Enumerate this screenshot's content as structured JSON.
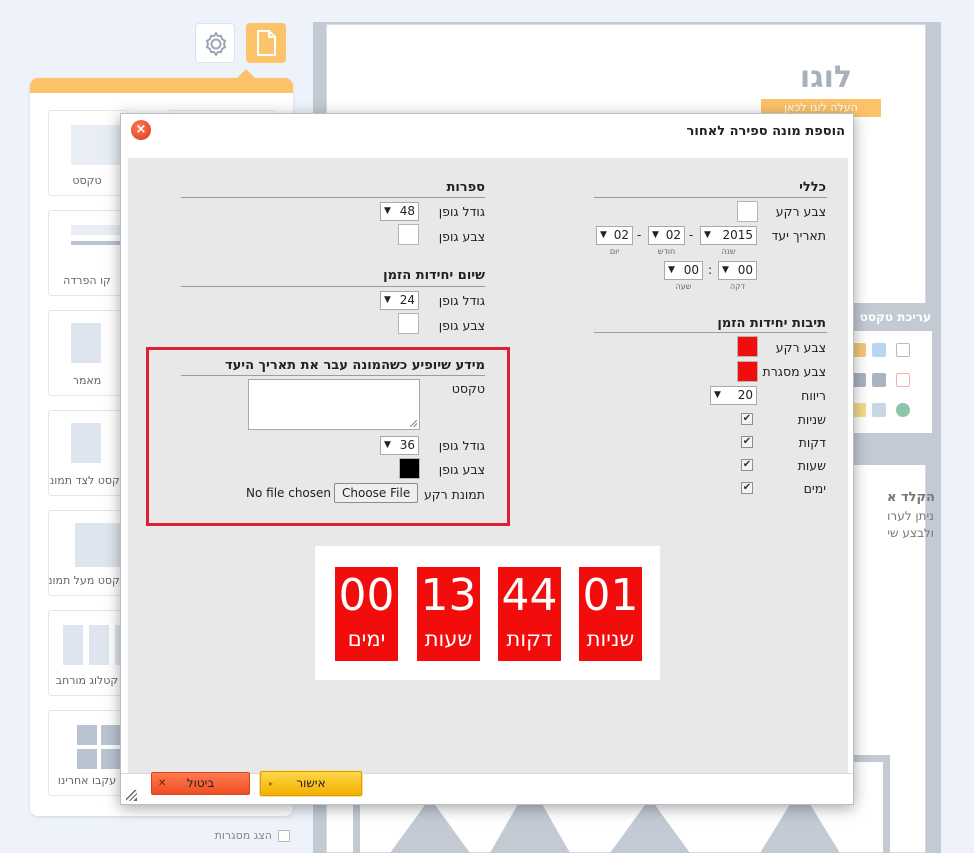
{
  "editor": {
    "logo_text": "לוגו",
    "logo_upload": "העלה לוגו לכאן",
    "tiles": [
      "טקסט",
      "קו הפרדה",
      "מאמר",
      "טקסט לצד תמונה",
      "טקסט מעל תמונה",
      "קטלוג מורחב",
      "עקבו אחרינו"
    ],
    "show_borders": "הצג מסגרות",
    "text_panel_title": "עריכת טקסט",
    "side_heading": "הקלד א",
    "side_line1": "ניתן לערו",
    "side_line2": "ולבצע שי"
  },
  "dialog": {
    "title": "הוספת מונה ספירה לאחור",
    "close_label": "×",
    "general": {
      "title": "כללי",
      "bg_color_label": "צבע רקע",
      "target_date_label": "תאריך יעד",
      "year": "2015",
      "month": "02",
      "day": "02",
      "year_caption": "שנה",
      "month_caption": "חודש",
      "day_caption": "יום",
      "minute": "00",
      "hour": "00",
      "minute_caption": "דקה",
      "hour_caption": "שעה",
      "dash": "-",
      "colon": ":"
    },
    "unit_boxes": {
      "title": "תיבות יחידות הזמן",
      "bg_color_label": "צבע רקע",
      "border_color_label": "צבע מסגרת",
      "spacing_label": "ריווח",
      "spacing_value": "20",
      "bg_color": "#f20c0c",
      "border_color": "#f20c0c",
      "checks": [
        {
          "label": "שניות",
          "checked": true
        },
        {
          "label": "דקות",
          "checked": true
        },
        {
          "label": "שעות",
          "checked": true
        },
        {
          "label": "ימים",
          "checked": true
        }
      ],
      "check_mark": "✔"
    },
    "digits": {
      "title": "ספרות",
      "font_size_label": "גודל גופן",
      "font_size": "48",
      "font_color_label": "צבע גופן"
    },
    "unit_names": {
      "title": "שיום יחידות הזמן",
      "font_size_label": "גודל גופן",
      "font_size": "24",
      "font_color_label": "צבע גופן"
    },
    "expired": {
      "title": "מידע שיופיע כשהמונה עבר את תאריך היעד",
      "text_label": "טקסט",
      "font_size_label": "גודל גופן",
      "font_size": "36",
      "font_color_label": "צבע גופן",
      "font_color": "#000000",
      "bg_image_label": "תמונת רקע",
      "choose_file": "Choose File",
      "file_status": "No file chosen"
    },
    "preview": [
      {
        "value": "01",
        "label": "שניות"
      },
      {
        "value": "44",
        "label": "דקות"
      },
      {
        "value": "13",
        "label": "שעות"
      },
      {
        "value": "00",
        "label": "ימים"
      }
    ],
    "ok_label": "אישור",
    "cancel_label": "ביטול",
    "ok_icon": "▸",
    "cancel_icon": "✕"
  }
}
